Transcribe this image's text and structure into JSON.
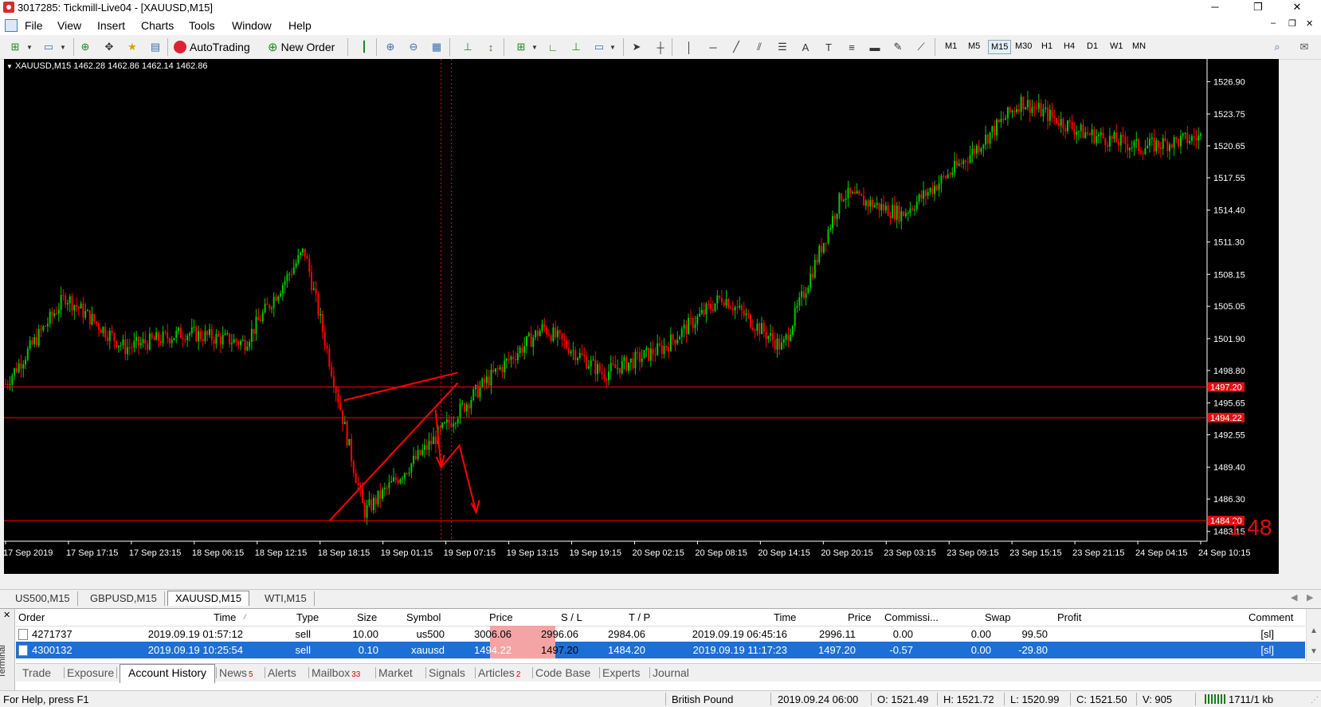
{
  "window": {
    "title": "3017285: Tickmill-Live04 - [XAUUSD,M15]",
    "controls": {
      "minimize": "─",
      "restore": "❐",
      "close": "✕"
    }
  },
  "menu": [
    "File",
    "View",
    "Insert",
    "Charts",
    "Tools",
    "Window",
    "Help"
  ],
  "toolbar": {
    "autotrading": "AutoTrading",
    "new_order": "New Order",
    "timeframes": [
      "M1",
      "M5",
      "M15",
      "M30",
      "H1",
      "H4",
      "D1",
      "W1",
      "MN"
    ],
    "active_timeframe": "M15"
  },
  "chart": {
    "info": "XAUUSD,M15  1462.28 1462.86 1462.14 1462.86",
    "price_axis": [
      "1526.90",
      "1523.75",
      "1520.65",
      "1517.55",
      "1514.40",
      "1511.30",
      "1508.15",
      "1505.05",
      "1501.90",
      "1498.80",
      "1495.65",
      "1492.55",
      "1489.40",
      "1486.30",
      "1483.15"
    ],
    "price_range": [
      1482.2,
      1529.1
    ],
    "time_axis": [
      "17 Sep 2019",
      "17 Sep 17:15",
      "17 Sep 23:15",
      "18 Sep 06:15",
      "18 Sep 12:15",
      "18 Sep 18:15",
      "19 Sep 01:15",
      "19 Sep 07:15",
      "19 Sep 13:15",
      "19 Sep 19:15",
      "20 Sep 02:15",
      "20 Sep 08:15",
      "20 Sep 14:15",
      "20 Sep 20:15",
      "23 Sep 03:15",
      "23 Sep 09:15",
      "23 Sep 15:15",
      "23 Sep 21:15",
      "24 Sep 04:15",
      "24 Sep 10:15"
    ],
    "hlines": [
      {
        "price": 1497.2,
        "label": "1497.20"
      },
      {
        "price": 1494.22,
        "label": "1494.22"
      },
      {
        "price": 1484.2,
        "label": "1484.20"
      }
    ],
    "big_label": "1.48",
    "colors": {
      "bull": "#00c800",
      "bear": "#ff0000",
      "line": "#ff0000",
      "bg": "#000000",
      "text": "#ffffff"
    }
  },
  "chart_data": {
    "type": "candlestick",
    "symbol": "XAUUSD",
    "timeframe": "M15",
    "anchors": [
      {
        "time": "17 Sep 2019",
        "price": 1497.5
      },
      {
        "time": "17 Sep 17:15",
        "price": 1506.0
      },
      {
        "time": "17 Sep 23:15",
        "price": 1501.0
      },
      {
        "time": "18 Sep 06:15",
        "price": 1502.5
      },
      {
        "time": "18 Sep 12:15",
        "price": 1501.5
      },
      {
        "time": "18 Sep 18:15",
        "price": 1510.5
      },
      {
        "time": "18 Sep 18:15",
        "price": 1485.0
      },
      {
        "time": "19 Sep 01:15",
        "price": 1491.0
      },
      {
        "time": "19 Sep 07:15",
        "price": 1497.5
      },
      {
        "time": "19 Sep 13:15",
        "price": 1503.0
      },
      {
        "time": "19 Sep 19:15",
        "price": 1498.5
      },
      {
        "time": "20 Sep 02:15",
        "price": 1501.0
      },
      {
        "time": "20 Sep 08:15",
        "price": 1506.0
      },
      {
        "time": "20 Sep 14:15",
        "price": 1501.0
      },
      {
        "time": "20 Sep 20:15",
        "price": 1516.0
      },
      {
        "time": "23 Sep 03:15",
        "price": 1514.0
      },
      {
        "time": "23 Sep 09:15",
        "price": 1519.0
      },
      {
        "time": "23 Sep 15:15",
        "price": 1525.0
      },
      {
        "time": "23 Sep 21:15",
        "price": 1522.0
      },
      {
        "time": "24 Sep 04:15",
        "price": 1520.5
      },
      {
        "time": "24 Sep 10:15",
        "price": 1521.5
      }
    ],
    "horizontal_levels": [
      1497.2,
      1494.22,
      1484.2
    ]
  },
  "chart_tabs": [
    "US500,M15",
    "GBPUSD,M15",
    "XAUUSD,M15",
    "WTI,M15"
  ],
  "active_chart_tab": "XAUUSD,M15",
  "terminal": {
    "side_label": "Terminal",
    "columns": [
      "Order",
      "Time",
      "Type",
      "Size",
      "Symbol",
      "Price",
      "S / L",
      "T / P",
      "Time",
      "Price",
      "Commissi...",
      "Swap",
      "Profit",
      "Comment"
    ],
    "rows": [
      [
        "4271737",
        "2019.09.19 01:57:12",
        "sell",
        "10.00",
        "us500",
        "3006.06",
        "2996.06",
        "2984.06",
        "2019.09.19 06:45:16",
        "2996.11",
        "0.00",
        "0.00",
        "99.50",
        "[sl]"
      ],
      [
        "4300132",
        "2019.09.19 10:25:54",
        "sell",
        "0.10",
        "xauusd",
        "1494.22",
        "1497.20",
        "1484.20",
        "2019.09.19 11:17:23",
        "1497.20",
        "-0.57",
        "0.00",
        "-29.80",
        "[sl]"
      ]
    ],
    "selected_row": 1,
    "tabs": [
      {
        "label": "Trade",
        "badge": ""
      },
      {
        "label": "Exposure",
        "badge": ""
      },
      {
        "label": "Account History",
        "badge": ""
      },
      {
        "label": "News",
        "badge": "5"
      },
      {
        "label": "Alerts",
        "badge": ""
      },
      {
        "label": "Mailbox",
        "badge": "33"
      },
      {
        "label": "Market",
        "badge": ""
      },
      {
        "label": "Signals",
        "badge": ""
      },
      {
        "label": "Articles",
        "badge": "2"
      },
      {
        "label": "Code Base",
        "badge": ""
      },
      {
        "label": "Experts",
        "badge": ""
      },
      {
        "label": "Journal",
        "badge": ""
      }
    ],
    "active_tab": "Account History"
  },
  "status": {
    "help": "For Help, press F1",
    "profile": "British Pound",
    "datetime": "2019.09.24 06:00",
    "open": "O: 1521.49",
    "high": "H: 1521.72",
    "low": "L: 1520.99",
    "close": "C: 1521.50",
    "volume": "V: 905",
    "traffic": "1711/1 kb"
  }
}
